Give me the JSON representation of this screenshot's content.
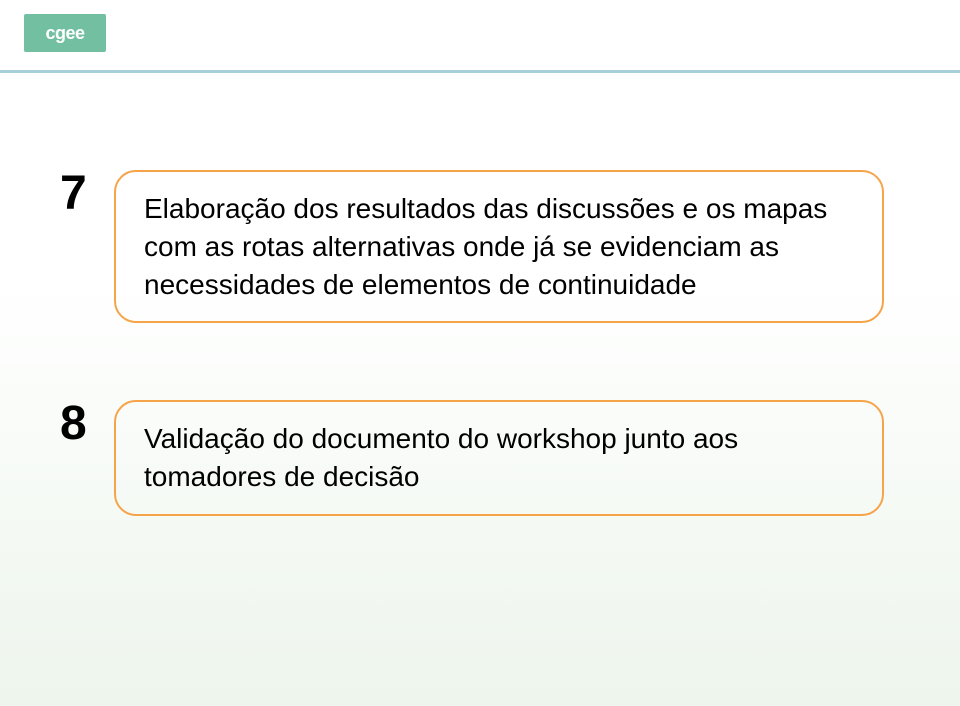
{
  "logo": {
    "text": "cgee"
  },
  "items": [
    {
      "number": "7",
      "text": "Elaboração dos resultados das discussões e os mapas com as rotas alternativas onde já se evidenciam as necessidades de elementos de continuidade"
    },
    {
      "number": "8",
      "text": "Validação do documento do workshop junto aos tomadores de decisão"
    }
  ]
}
